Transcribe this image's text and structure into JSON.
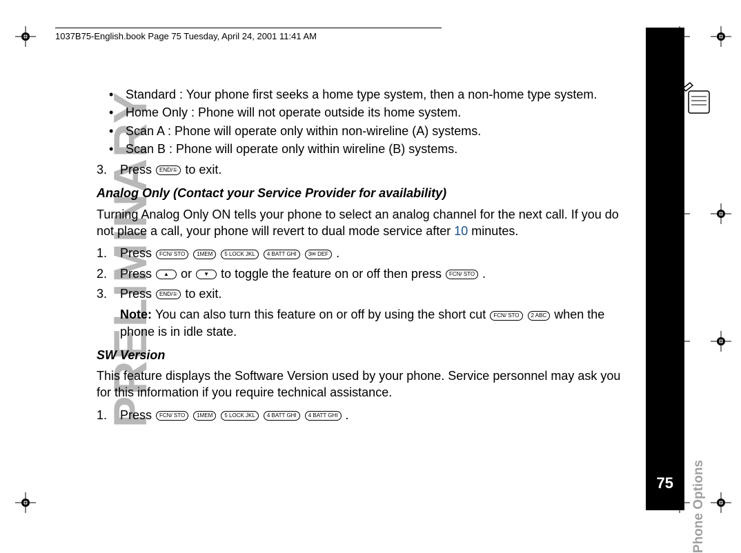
{
  "header": "1037B75-English.book  Page 75  Tuesday, April 24, 2001  11:41 AM",
  "bullets": {
    "b1": "Standard : Your phone first seeks a home type system, then a non-home type system.",
    "b2": "Home Only : Phone will not operate outside its home system.",
    "b3": "Scan A : Phone will operate only within non-wireline (A) systems.",
    "b4": "Scan B : Phone will operate only within wireline (B) systems."
  },
  "step3a": {
    "num": "3.",
    "before": "Press ",
    "after": " to exit."
  },
  "analog": {
    "heading": "Analog Only (Contact your Service Provider for availability)",
    "para_before": "Turning Analog Only ON tells your phone to select an analog channel for the next call. If you do not place a call, your phone will revert to dual mode service after ",
    "ten": "10",
    "para_after": " minutes.",
    "s1": {
      "num": "1.",
      "text": "Press ",
      "after": "."
    },
    "s2": {
      "num": "2.",
      "before": "Press ",
      "mid1": " or ",
      "mid2": " to toggle the feature on or off then press ",
      "after": "."
    },
    "s3": {
      "num": "3.",
      "before": "Press ",
      "after": " to exit."
    }
  },
  "note": {
    "label": "Note: ",
    "before": "You can also turn this feature on or off by using the short cut ",
    "after": " when the phone is in idle state."
  },
  "sw": {
    "heading": "SW Version",
    "para": "This feature displays the Software Version used by your phone. Service personnel may ask you for this information if you require technical assistance.",
    "s1": {
      "num": "1.",
      "before": "Press ",
      "after": "."
    }
  },
  "keys": {
    "end": "END/①",
    "fcn": "FCN/\nSTO",
    "one": "1MEM",
    "five": "5 LOCK\nJKL",
    "four": "4 BATT\nGHI",
    "three": "3✉\nDEF",
    "up": "▲",
    "down": "▼",
    "two": "2 ABC"
  },
  "sidebar": "Phone Options",
  "pagenum": "75",
  "watermark": "PRELIMINARY"
}
